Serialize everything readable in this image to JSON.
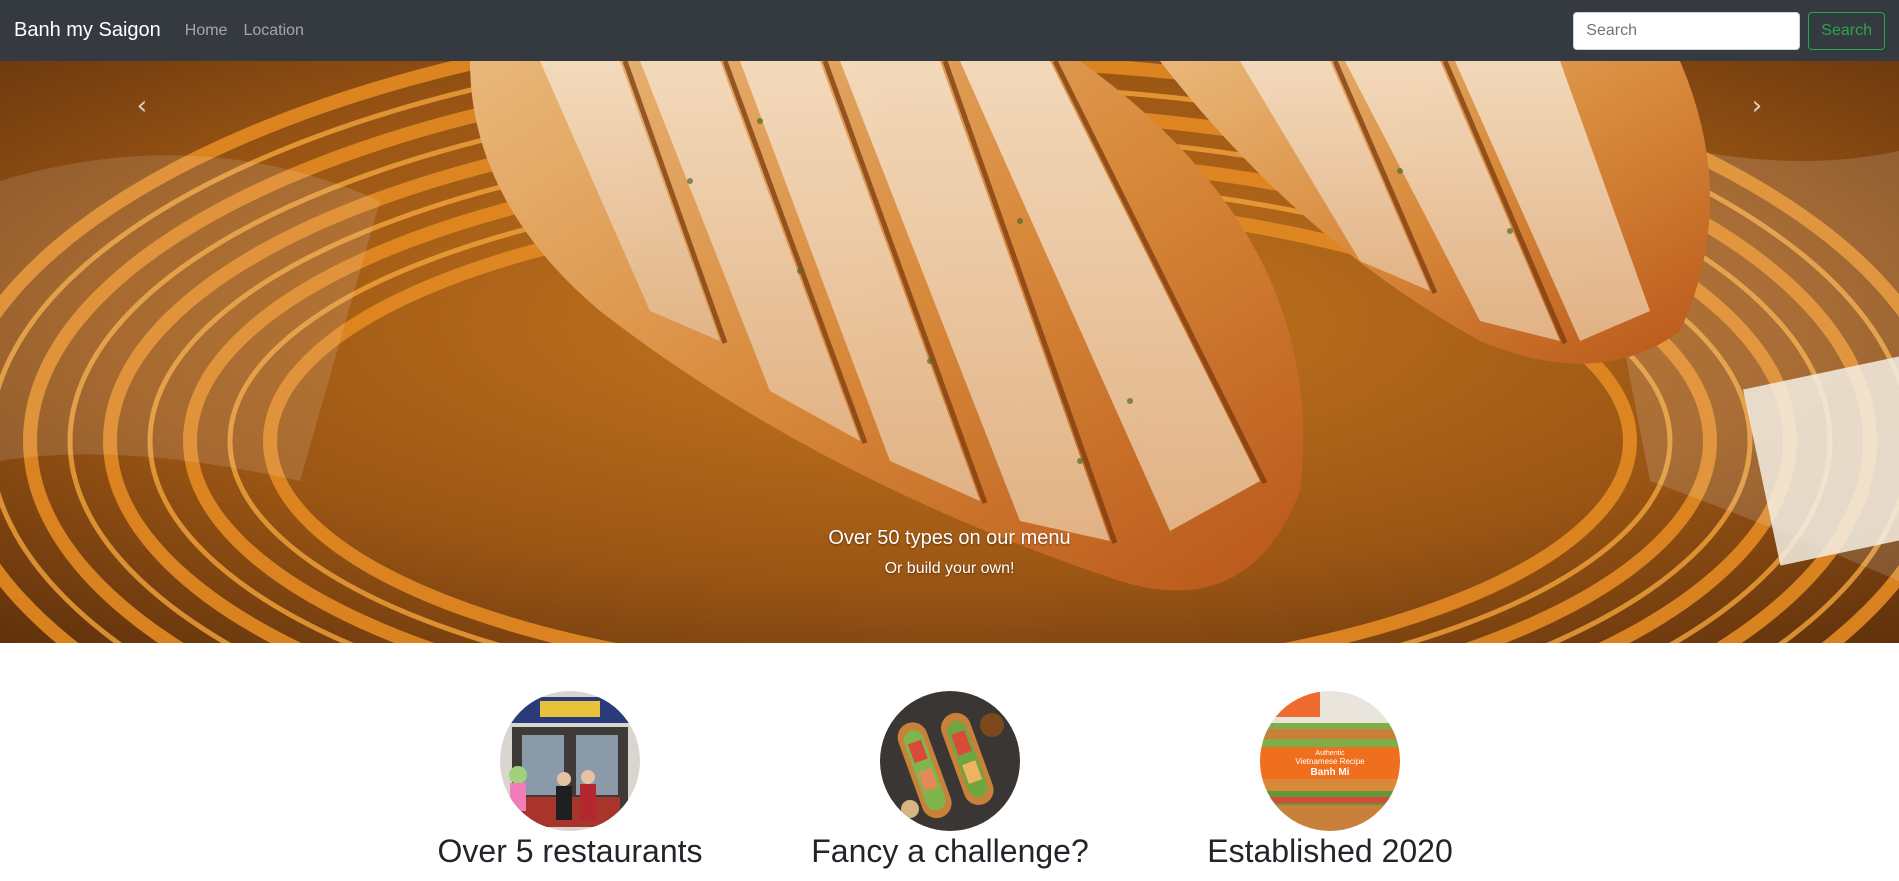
{
  "navbar": {
    "brand": "Banh my Saigon",
    "links": [
      "Home",
      "Location"
    ],
    "search_placeholder": "Search",
    "search_button": "Search"
  },
  "carousel": {
    "caption_title": "Over 50 types on our menu",
    "caption_text": "Or build your own!",
    "prev_icon": "chevron-left-icon",
    "next_icon": "chevron-right-icon"
  },
  "features": [
    {
      "title": "Over 5 restaurants",
      "image": "storefront-photo"
    },
    {
      "title": "Fancy a challenge?",
      "image": "banh-mi-sandwiches-photo"
    },
    {
      "title": "Established 2020",
      "image": "banh-mi-poster-photo",
      "poster_lines": [
        "Authentic",
        "Vietnamese Recipe",
        "Banh Mi"
      ]
    }
  ],
  "colors": {
    "navbar_bg": "#343a40",
    "search_accent": "#28a745",
    "heading_text": "#212529"
  }
}
